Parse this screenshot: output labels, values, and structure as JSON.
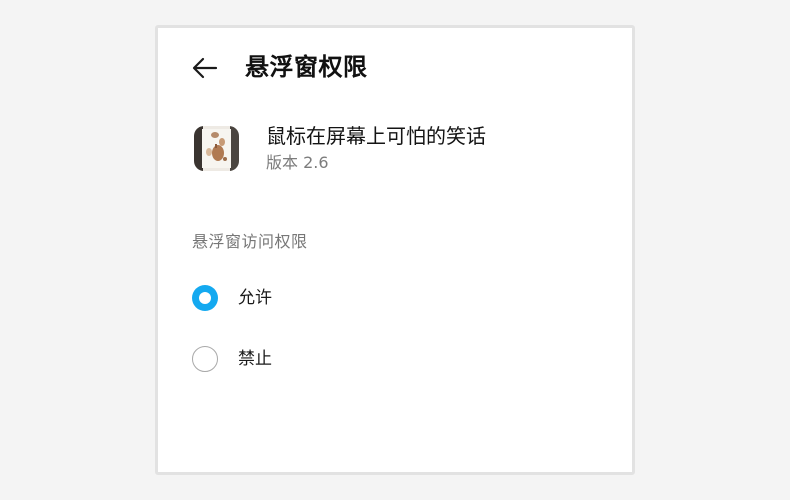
{
  "header": {
    "title": "悬浮窗权限",
    "back_icon": "arrow-left-icon"
  },
  "app": {
    "name": "鼠标在屏幕上可怕的笑话",
    "version": "版本 2.6",
    "icon": "app-icon"
  },
  "permission": {
    "section_label": "悬浮窗访问权限",
    "options": [
      {
        "label": "允许",
        "selected": true
      },
      {
        "label": "禁止",
        "selected": false
      }
    ]
  },
  "colors": {
    "accent": "#14a9f0",
    "background": "#f4f4f4",
    "panel": "#ffffff"
  }
}
